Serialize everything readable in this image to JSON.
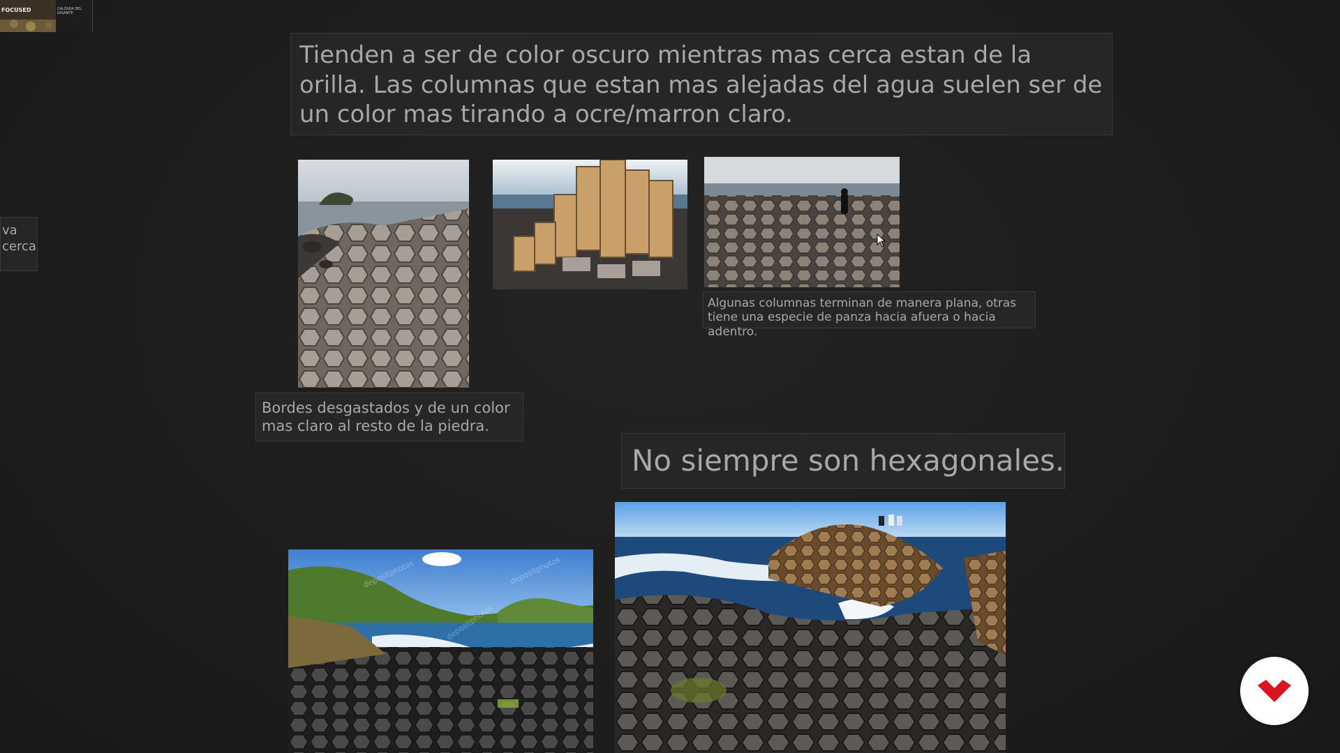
{
  "notes": {
    "top_text": "Tienden a ser de color oscuro mientras mas cerca estan de la orilla. Las columnas que estan mas alejadas del agua suelen ser de un color mas tirando a ocre/marron claro.",
    "left_partial_line1": "va",
    "left_partial_line2": "cerca",
    "plane_columns_caption": "Algunas columnas terminan de manera plana, otras tiene una especie de panza hacia afuera o hacia adentro.",
    "worn_edges_caption": "Bordes desgastados y de un color mas claro al resto de la piedra.",
    "heading": "No siempre son hexagonales."
  },
  "thumbnail": {
    "title": "FOCUSED",
    "subtitle": "CALZADA DEL GIGANTE"
  },
  "watermarks": {
    "stock": "depositphotos"
  },
  "icons": {
    "brand_logo": "red-chevron-logo-icon",
    "cursor": "mouse-pointer-icon"
  },
  "colors": {
    "background": "#1f1f1f",
    "note_bg": "#262626",
    "note_text": "#a8a8a8",
    "brand_red": "#d9141f"
  }
}
